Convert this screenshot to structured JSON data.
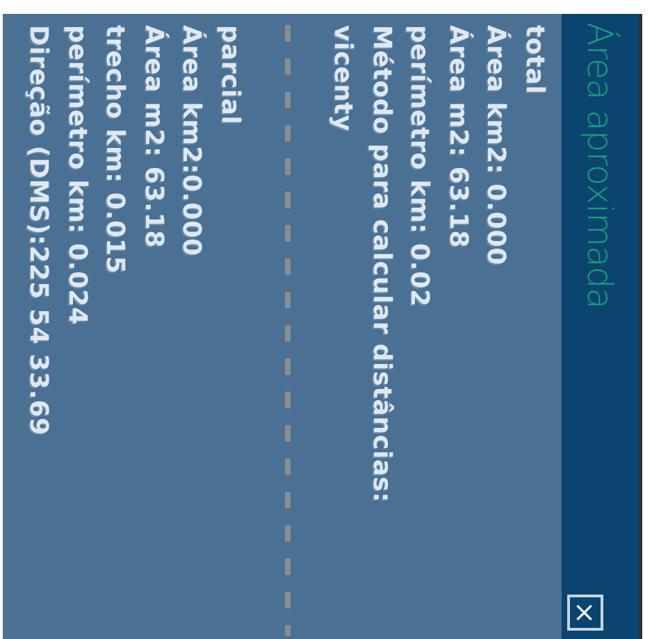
{
  "panel": {
    "title": "Área aproximada",
    "close_label": "×"
  },
  "sections": [
    {
      "heading": "total",
      "lines": [
        "Área km2: 0.000",
        "Área m2: 63.18",
        "perímetro km: 0.02",
        "Método para calcular distâncias:",
        "vicenty"
      ]
    },
    {
      "heading": "parcial",
      "lines": [
        "Área km2:0.000",
        "Área m2: 63.18",
        "trecho km: 0.015",
        "perímetro km: 0.024",
        "Direção (DMS):225 54 33.69"
      ]
    }
  ]
}
